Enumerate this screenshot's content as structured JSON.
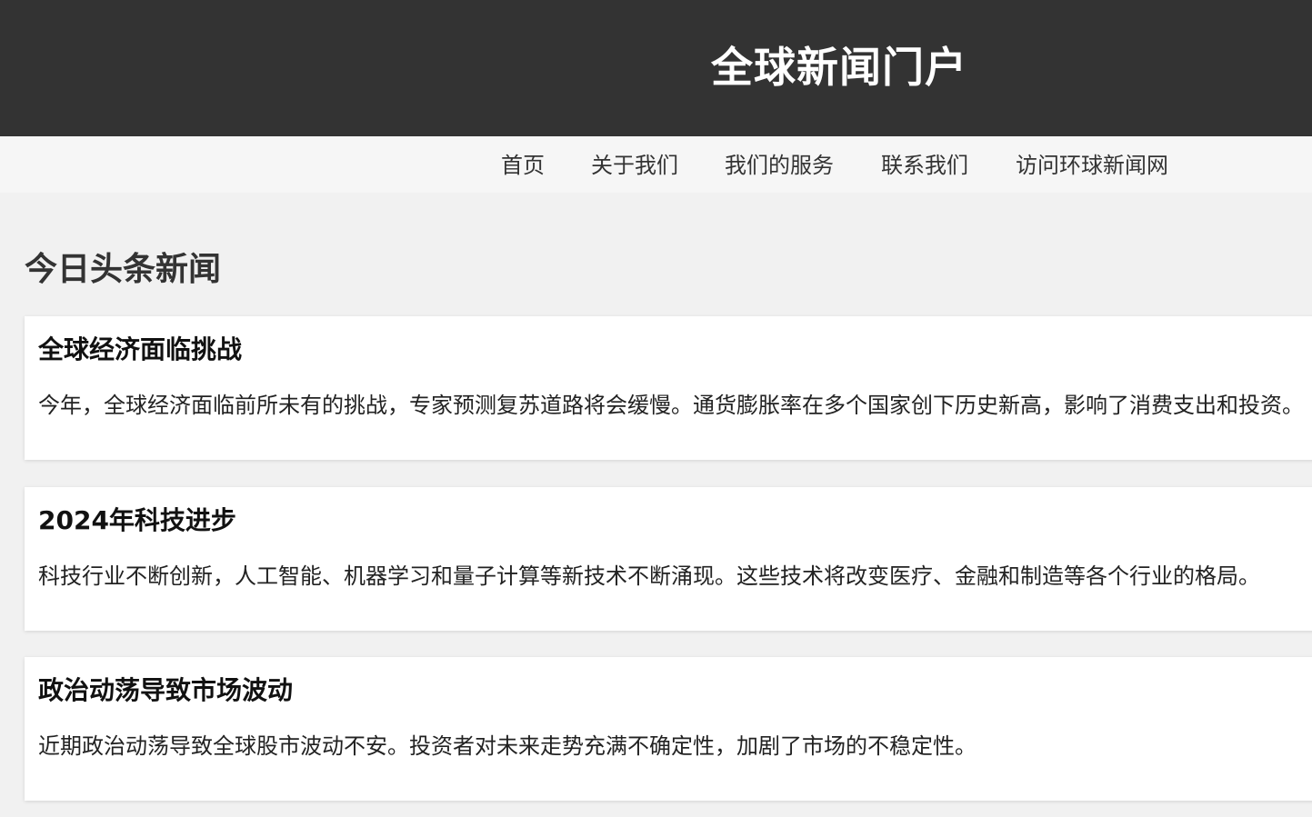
{
  "header": {
    "title": "全球新闻门户"
  },
  "nav": {
    "items": [
      {
        "label": "首页"
      },
      {
        "label": "关于我们"
      },
      {
        "label": "我们的服务"
      },
      {
        "label": "联系我们"
      },
      {
        "label": "访问环球新闻网"
      }
    ]
  },
  "main": {
    "heading": "今日头条新闻",
    "articles": [
      {
        "title": "全球经济面临挑战",
        "body": "今年，全球经济面临前所未有的挑战，专家预测复苏道路将会缓慢。通货膨胀率在多个国家创下历史新高，影响了消费支出和投资。"
      },
      {
        "title": "2024年科技进步",
        "body": "科技行业不断创新，人工智能、机器学习和量子计算等新技术不断涌现。这些技术将改变医疗、金融和制造等各个行业的格局。"
      },
      {
        "title": "政治动荡导致市场波动",
        "body": "近期政治动荡导致全球股市波动不安。投资者对未来走势充满不确定性，加剧了市场的不稳定性。"
      }
    ]
  },
  "colors": {
    "header_bg": "#333333",
    "nav_bg": "#f6f6f6",
    "page_bg": "#f1f1f1",
    "card_bg": "#ffffff"
  }
}
